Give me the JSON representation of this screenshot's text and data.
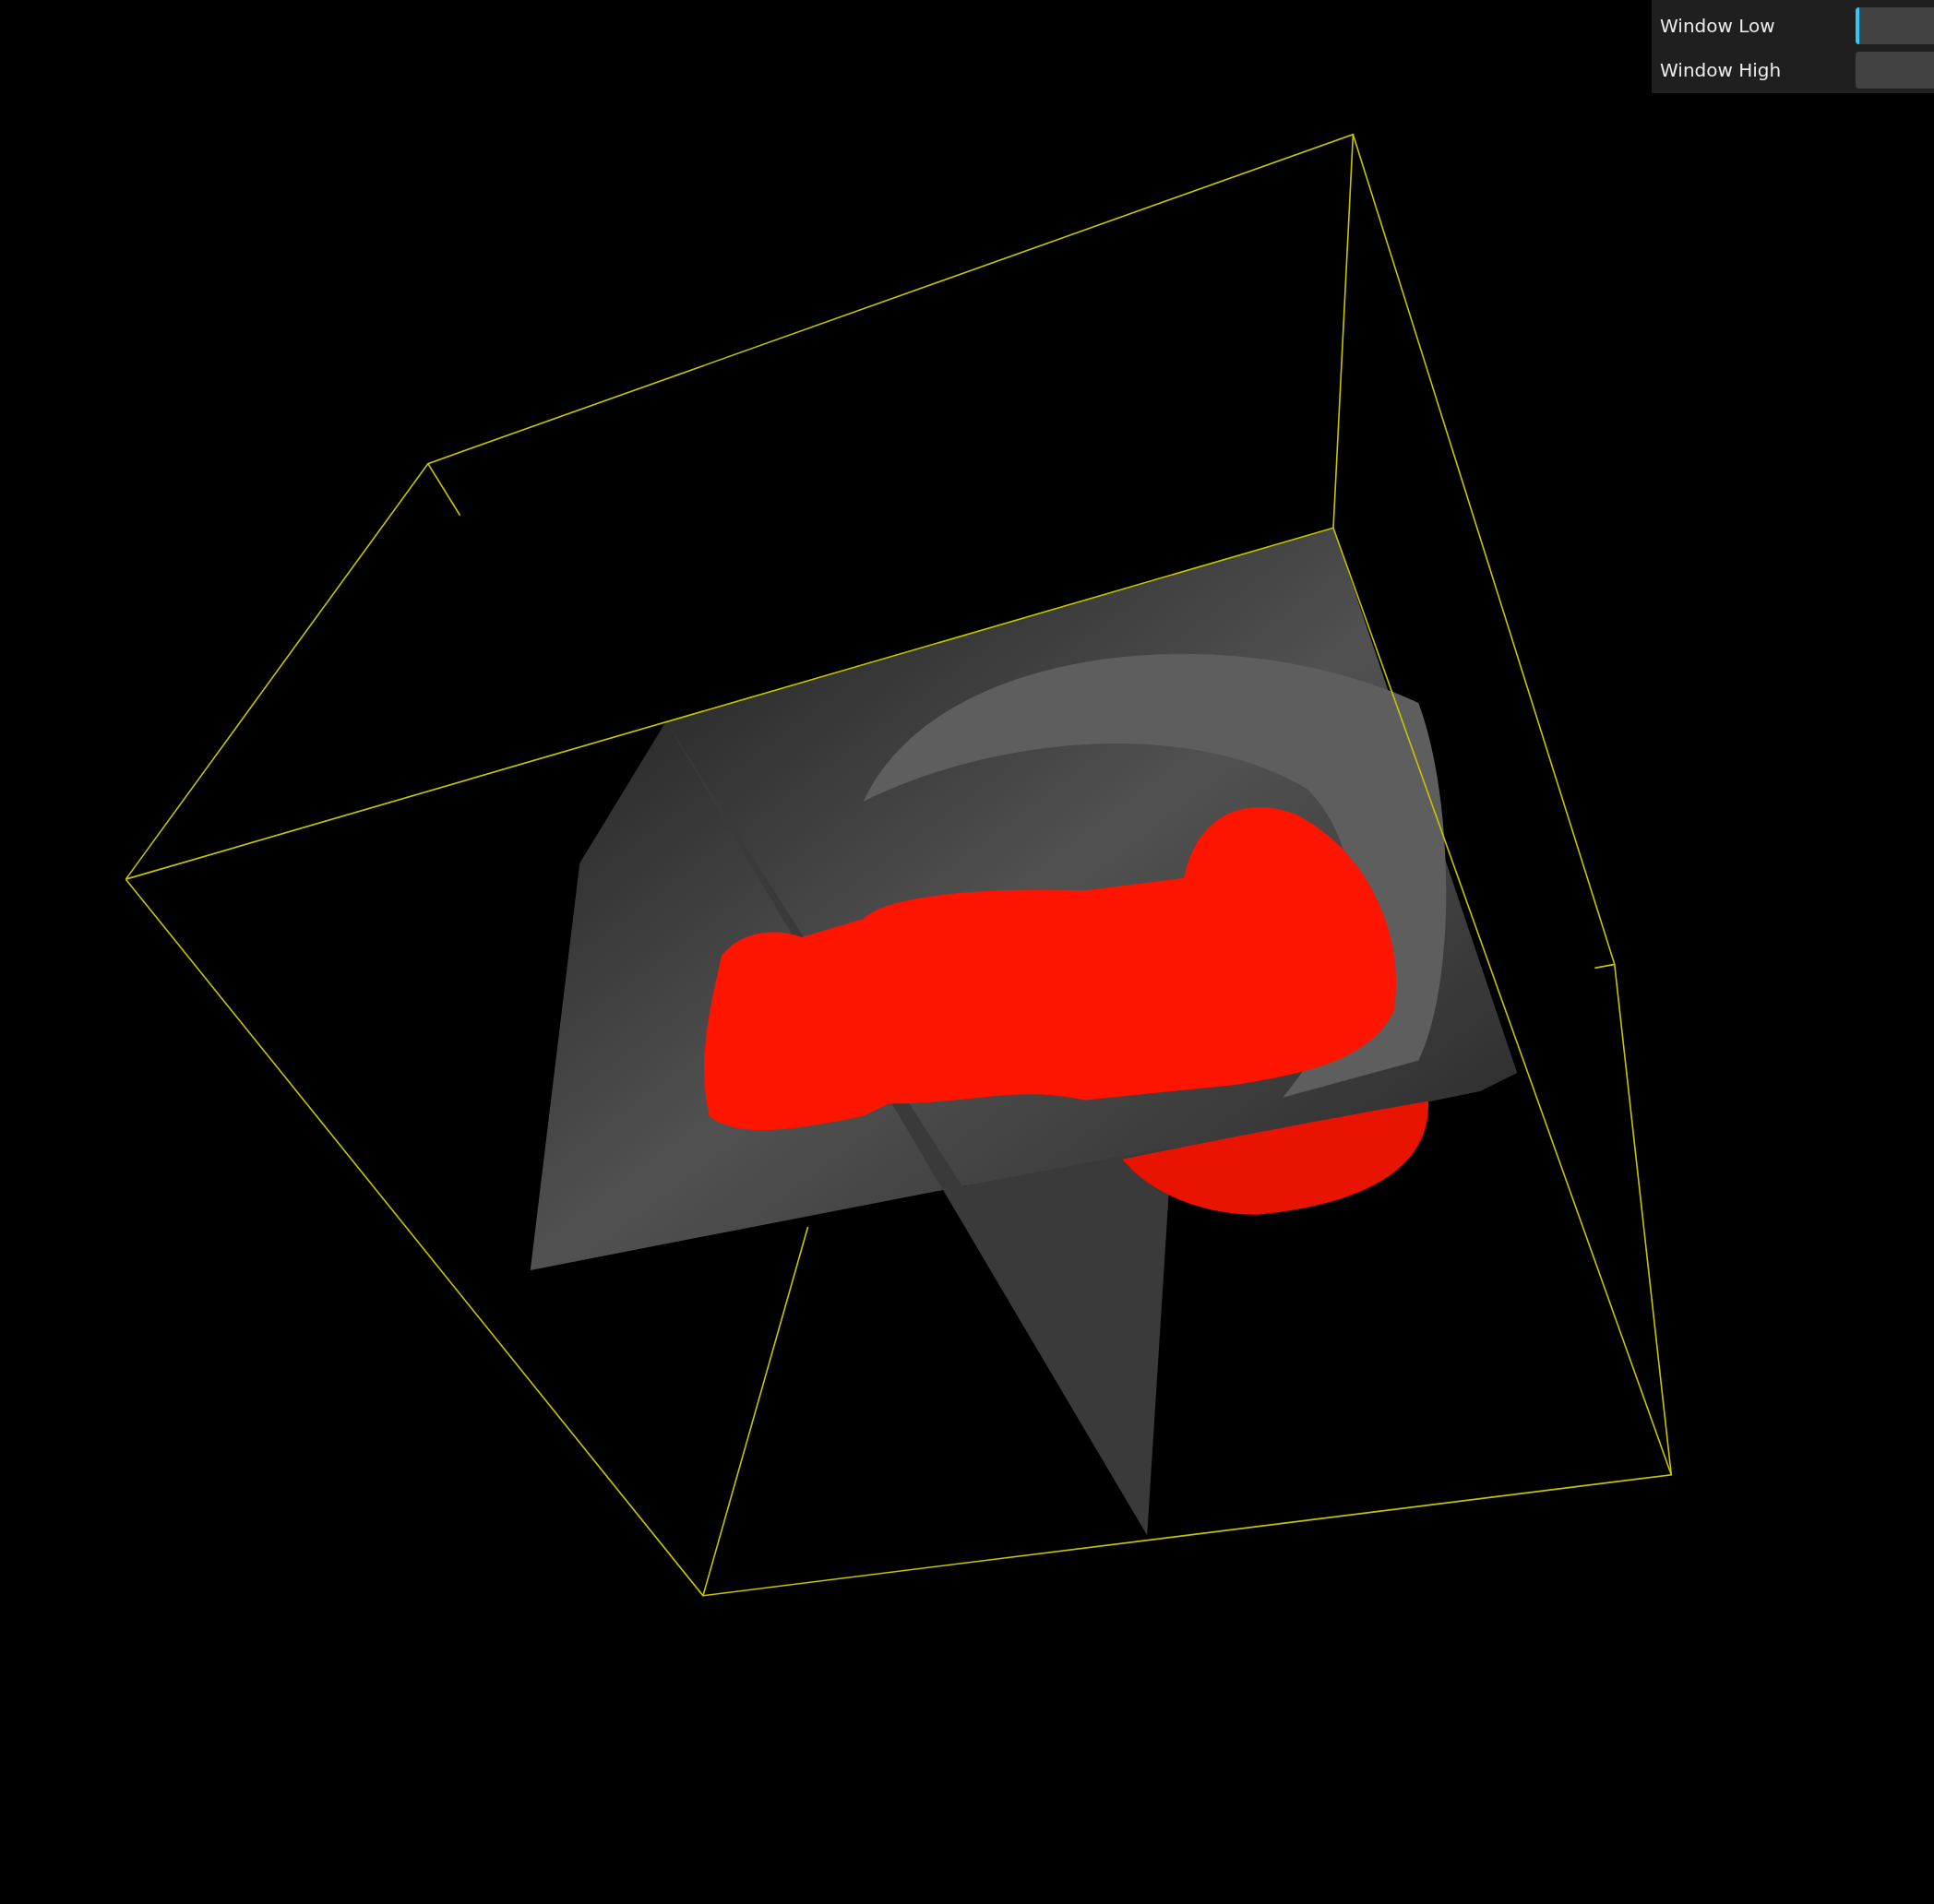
{
  "controls": [
    {
      "label": "Window Low",
      "level": 0
    },
    {
      "label": "Window High",
      "level": 1
    }
  ]
}
